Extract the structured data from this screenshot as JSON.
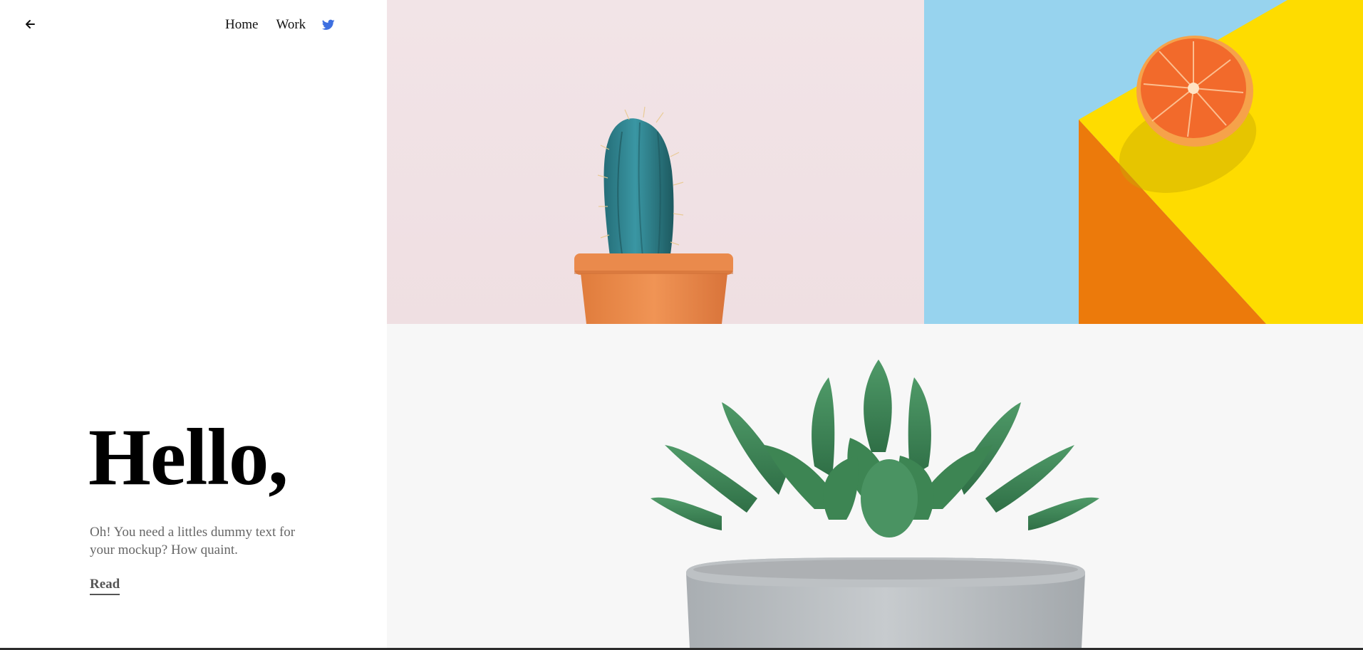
{
  "nav": {
    "back_icon": "arrow-left-icon",
    "home_label": "Home",
    "work_label": "Work",
    "social_icon": "twitter-icon",
    "social_color": "#3d6fe0"
  },
  "hero": {
    "title": "Hello,",
    "text": "Oh! You need a littles dummy text for your mockup? How quaint.",
    "read_label": "Read"
  },
  "gallery": {
    "tiles": [
      {
        "name": "cactus-photo",
        "colors": {
          "bg": "#f2e4e7",
          "pot": "#e8894a",
          "plant": "#2e8a8c"
        }
      },
      {
        "name": "orange-photo",
        "colors": {
          "bg": "#97d3ee",
          "yellow": "#fedc00",
          "orange": "#ec7a0b",
          "fruit": "#f36c2c"
        }
      },
      {
        "name": "succulent-photo",
        "colors": {
          "bg": "#f7f7f7",
          "leaf": "#3f8a58",
          "pot": "#b9bdc0"
        }
      }
    ]
  }
}
